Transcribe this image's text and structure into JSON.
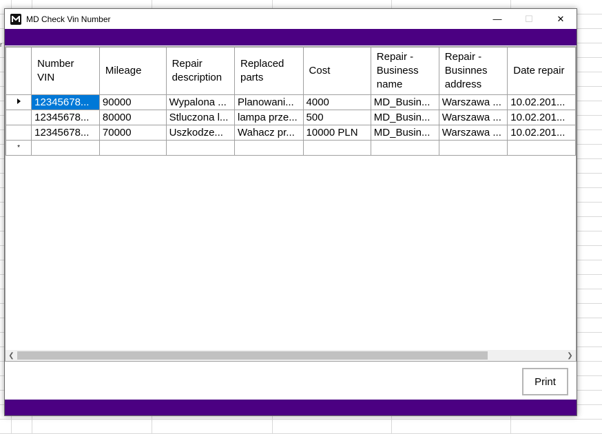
{
  "window": {
    "title": "MD Check Vin Number",
    "controls": {
      "minimize": "—",
      "maximize": "☐",
      "close": "✕"
    }
  },
  "background": {
    "edge_text": "r"
  },
  "grid": {
    "columns": [
      "Number VIN",
      "Mileage",
      "Repair description",
      "Replaced parts",
      "Cost",
      "Repair - Business name",
      "Repair - Businnes address",
      "Date repair"
    ],
    "rows": [
      [
        "12345678...",
        "90000",
        "Wypalona ...",
        "Planowani...",
        "4000",
        "MD_Busin...",
        "Warszawa ...",
        "10.02.201..."
      ],
      [
        "12345678...",
        "80000",
        "Stluczona l...",
        "lampa prze...",
        "500",
        "MD_Busin...",
        "Warszawa ...",
        "10.02.201..."
      ],
      [
        "12345678...",
        "70000",
        "Uszkodze...",
        "Wahacz pr...",
        "10000 PLN",
        "MD_Busin...",
        "Warszawa ...",
        "10.02.201..."
      ]
    ],
    "new_row_marker": "*",
    "selected_cell": {
      "row": 0,
      "col": 0
    },
    "scroll_fraction": 0.86
  },
  "print_label": "Print",
  "colors": {
    "accent": "#4b0082",
    "selection": "#0078d7"
  }
}
